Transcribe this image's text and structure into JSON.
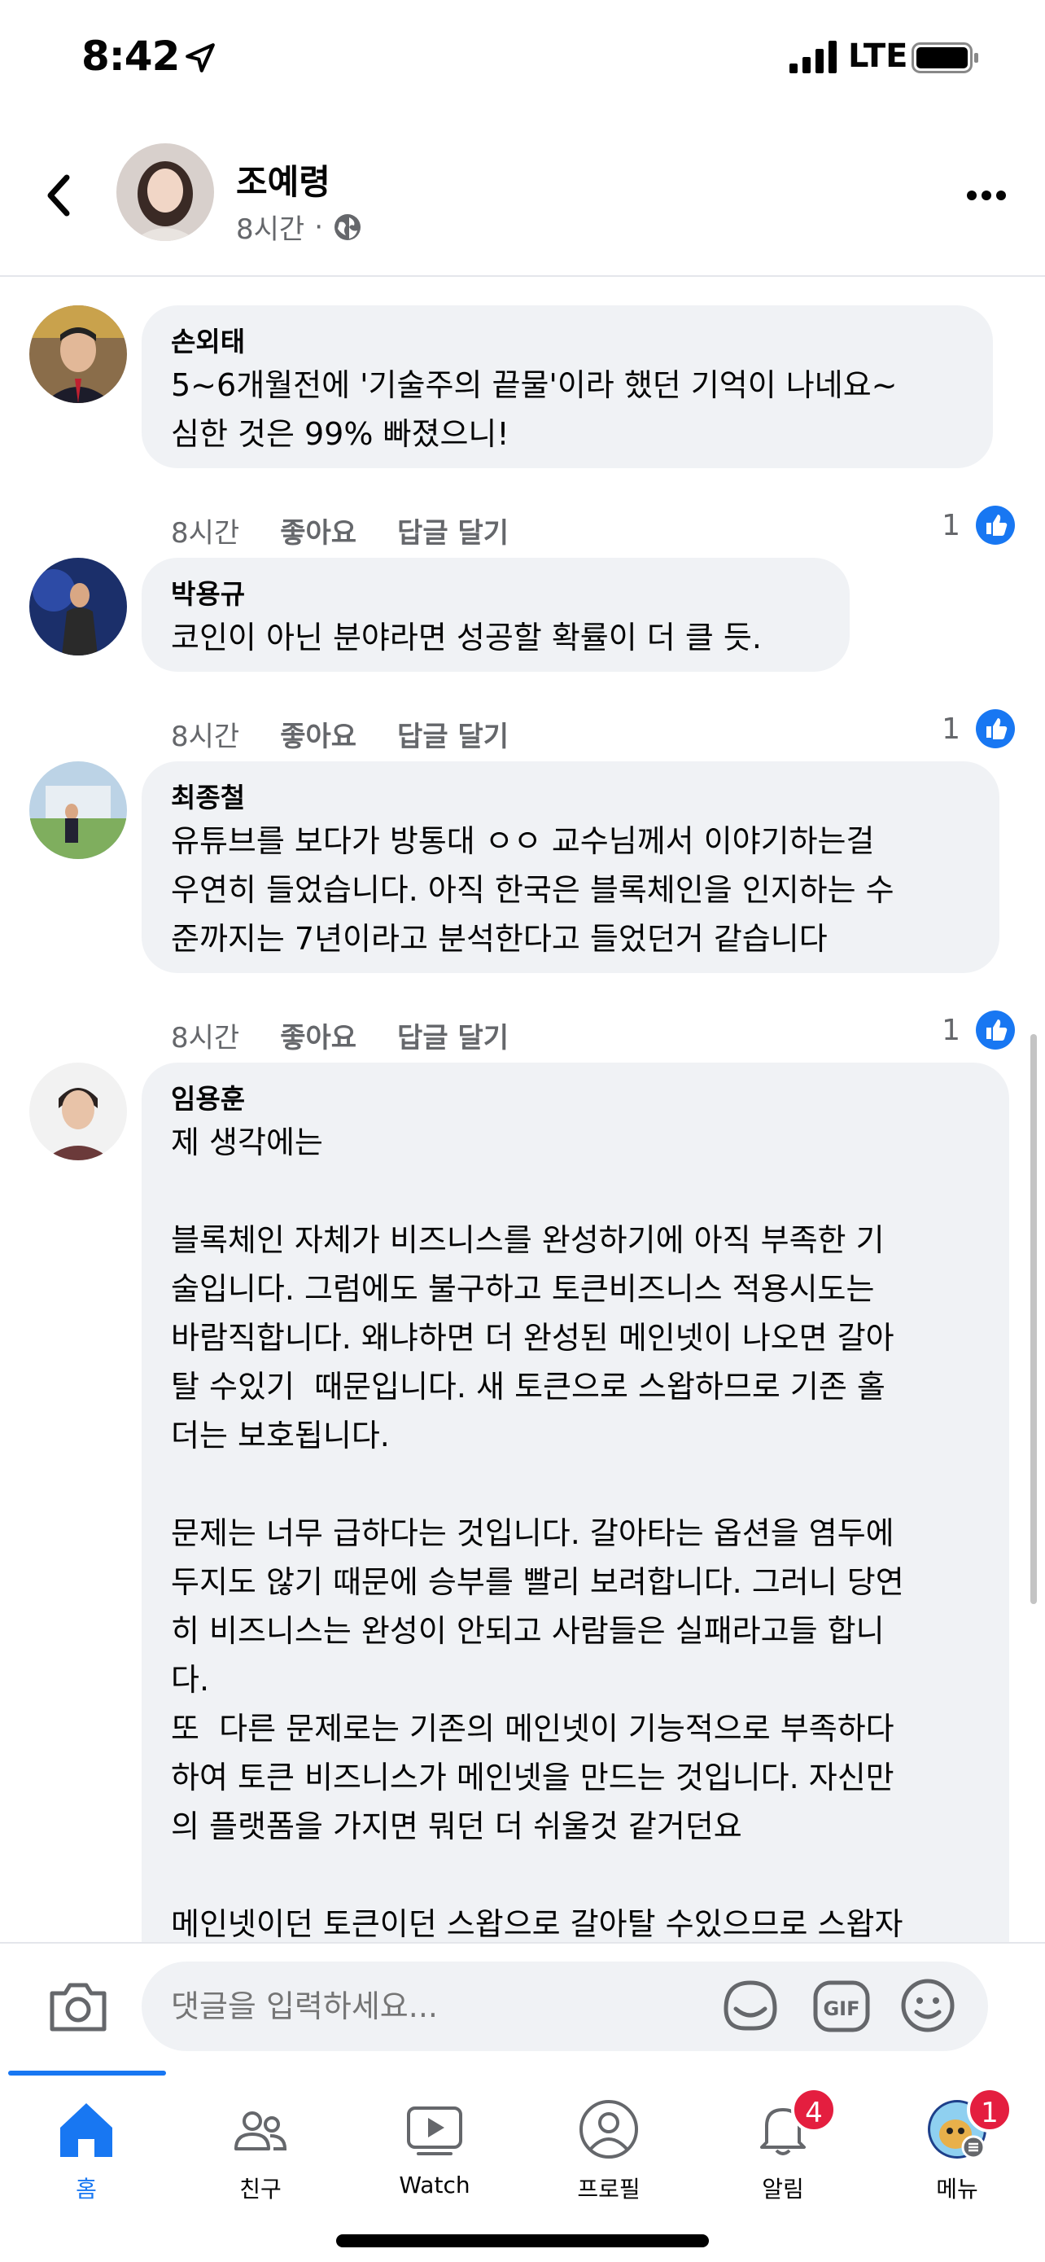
{
  "status_bar": {
    "time": "8:42",
    "network": "LTE"
  },
  "header": {
    "name": "조예령",
    "time": "8시간",
    "separator": "·"
  },
  "comments": [
    {
      "name": "손외태",
      "text": "5~6개월전에 '기술주의 끝물'이라 했던 기억이 나네요~\n심한 것은 99% 빠졌으니!",
      "time": "8시간",
      "like_label": "좋아요",
      "reply_label": "답글 달기",
      "likes": "1"
    },
    {
      "name": "박용규",
      "text": "코인이 아닌 분야라면 성공할 확률이 더 클 듯.",
      "time": "8시간",
      "like_label": "좋아요",
      "reply_label": "답글 달기",
      "likes": "1"
    },
    {
      "name": "최종철",
      "text": "유튜브를 보다가 방통대 ㅇㅇ 교수님께서 이야기하는걸\n우연히 들었습니다. 아직 한국은 블록체인을 인지하는 수\n준까지는 7년이라고 분석한다고 들었던거 같습니다",
      "time": "8시간",
      "like_label": "좋아요",
      "reply_label": "답글 달기",
      "likes": "1"
    },
    {
      "name": "임용훈",
      "text": "제 생각에는\n\n블록체인 자체가 비즈니스를 완성하기에 아직 부족한 기\n술입니다. 그럼에도 불구하고 토큰비즈니스 적용시도는\n바람직합니다. 왜냐하면 더 완성된 메인넷이 나오면 갈아\n탈 수있기  때문입니다. 새 토큰으로 스왑하므로 기존 홀\n더는 보호됩니다.\n\n문제는 너무 급하다는 것입니다. 갈아타는 옵션을 염두에\n두지도 않기 때문에 승부를 빨리 보려합니다. 그러니 당연\n히 비즈니스는 완성이 안되고 사람들은 실패라고들 합니\n다.\n또  다른 문제로는 기존의 메인넷이 기능적으로 부족하다\n하여 토큰 비즈니스가 메인넷을 만드는 것입니다. 자신만\n의 플랫폼을 가지면 뭐던 더 쉬울것 같거던요\n\n메인넷이던 토큰이던 스왑으로 갈아탈 수있으므로 스왑자"
    }
  ],
  "composer": {
    "placeholder": "댓글을 입력하세요..."
  },
  "nav": [
    {
      "label": "홈",
      "icon": "home-icon",
      "active": true
    },
    {
      "label": "친구",
      "icon": "friends-icon"
    },
    {
      "label": "Watch",
      "icon": "watch-icon"
    },
    {
      "label": "프로필",
      "icon": "profile-icon"
    },
    {
      "label": "알림",
      "icon": "bell-icon",
      "badge": "4"
    },
    {
      "label": "메뉴",
      "icon": "menu-avatar-icon",
      "badge": "1"
    }
  ],
  "colors": {
    "accent": "#1877f2",
    "bubble": "#f0f2f5",
    "muted": "#65676b",
    "badge": "#e41e3f"
  }
}
